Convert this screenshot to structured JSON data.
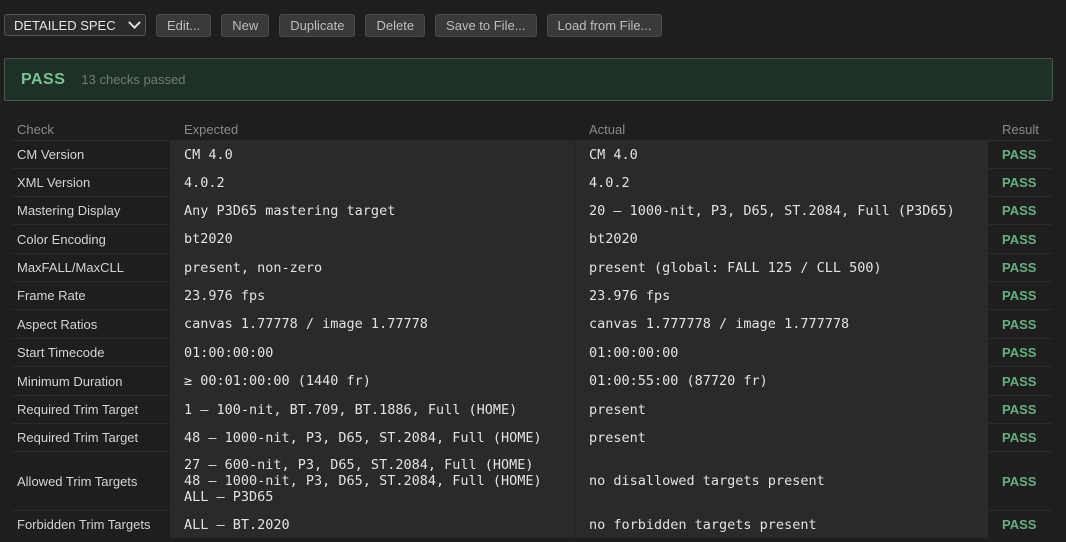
{
  "toolbar": {
    "preset_value": "DETAILED SPEC",
    "buttons": [
      "Edit...",
      "New",
      "Duplicate",
      "Delete",
      "Save to File...",
      "Load from File..."
    ]
  },
  "banner": {
    "status": "PASS",
    "summary": "13 checks passed"
  },
  "columns": {
    "check": "Check",
    "expected": "Expected",
    "actual": "Actual",
    "result": "Result"
  },
  "rows": [
    {
      "check": "CM Version",
      "expected": [
        "CM 4.0"
      ],
      "actual": "CM 4.0",
      "result": "PASS"
    },
    {
      "check": "XML Version",
      "expected": [
        "4.0.2"
      ],
      "actual": "4.0.2",
      "result": "PASS"
    },
    {
      "check": "Mastering Display",
      "expected": [
        "Any P3D65 mastering target"
      ],
      "actual": "20 — 1000-nit, P3, D65, ST.2084, Full (P3D65)",
      "result": "PASS"
    },
    {
      "check": "Color Encoding",
      "expected": [
        "bt2020"
      ],
      "actual": "bt2020",
      "result": "PASS"
    },
    {
      "check": "MaxFALL/MaxCLL",
      "expected": [
        "present, non-zero"
      ],
      "actual": "present (global: FALL 125 / CLL 500)",
      "result": "PASS"
    },
    {
      "check": "Frame Rate",
      "expected": [
        "23.976 fps"
      ],
      "actual": "23.976 fps",
      "result": "PASS"
    },
    {
      "check": "Aspect Ratios",
      "expected": [
        "canvas 1.77778 / image 1.77778"
      ],
      "actual": "canvas 1.777778 / image 1.777778",
      "result": "PASS"
    },
    {
      "check": "Start Timecode",
      "expected": [
        "01:00:00:00"
      ],
      "actual": "01:00:00:00",
      "result": "PASS"
    },
    {
      "check": "Minimum Duration",
      "expected": [
        "≥ 00:01:00:00 (1440 fr)"
      ],
      "actual": "01:00:55:00 (87720 fr)",
      "result": "PASS"
    },
    {
      "check": "Required Trim Target",
      "expected": [
        "1 — 100-nit, BT.709, BT.1886, Full (HOME)"
      ],
      "actual": "present",
      "result": "PASS"
    },
    {
      "check": "Required Trim Target",
      "expected": [
        "48 — 1000-nit, P3, D65, ST.2084, Full (HOME)"
      ],
      "actual": "present",
      "result": "PASS"
    },
    {
      "check": "Allowed Trim Targets",
      "expected": [
        "27 — 600-nit, P3, D65, ST.2084, Full (HOME)",
        "48 — 1000-nit, P3, D65, ST.2084, Full (HOME)",
        "ALL — P3D65"
      ],
      "actual": "no disallowed targets present",
      "result": "PASS"
    },
    {
      "check": "Forbidden Trim Targets",
      "expected": [
        "ALL — BT.2020"
      ],
      "actual": "no forbidden targets present",
      "result": "PASS"
    }
  ]
}
